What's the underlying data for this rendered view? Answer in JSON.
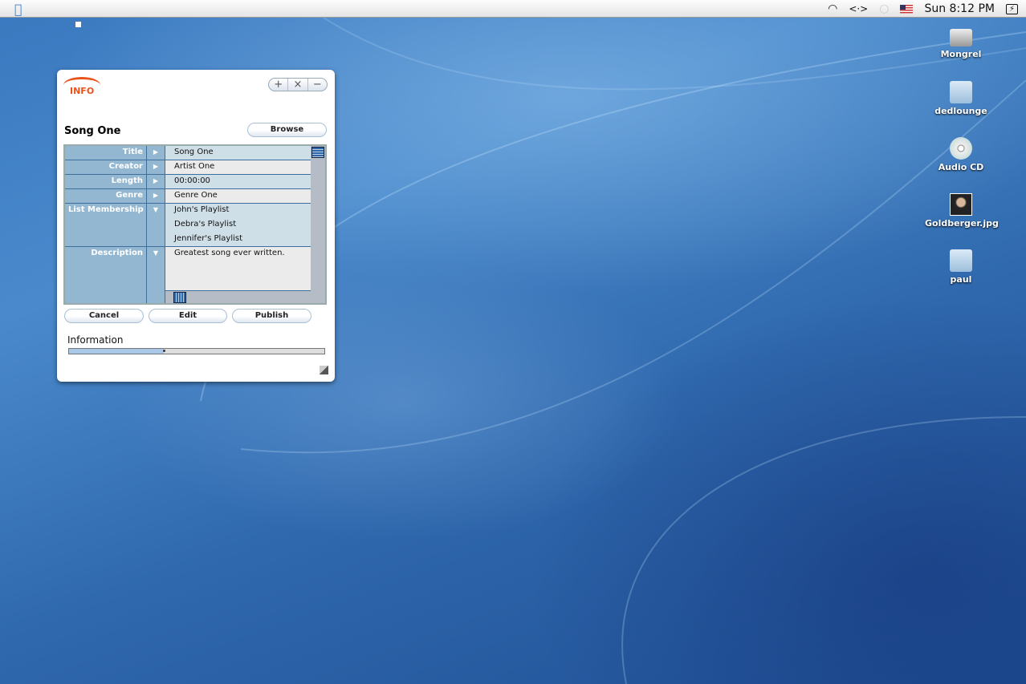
{
  "menubar": {
    "clock": "Sun 8:12 PM",
    "icons": [
      "apple-icon",
      "wifi-icon",
      "network-icon",
      "chat-icon",
      "flag-icon",
      "battery-icon"
    ]
  },
  "window": {
    "logo": "INFO",
    "controls": [
      "+",
      "×",
      "−"
    ],
    "song_title": "Song One",
    "browse_label": "Browse",
    "fields": [
      {
        "label": "Title",
        "values": [
          "Song One"
        ],
        "expanded": false
      },
      {
        "label": "Creator",
        "values": [
          "Artist One"
        ],
        "expanded": false
      },
      {
        "label": "Length",
        "values": [
          "00:00:00"
        ],
        "expanded": false
      },
      {
        "label": "Genre",
        "values": [
          "Genre One"
        ],
        "expanded": false
      },
      {
        "label": "List Membership",
        "values": [
          "John's Playlist",
          "Debra's Playlist",
          "Jennifer's Playlist"
        ],
        "expanded": true
      },
      {
        "label": "Description",
        "values": [
          "Greatest song ever written."
        ],
        "expanded": true
      }
    ],
    "buttons": {
      "cancel": "Cancel",
      "edit": "Edit",
      "publish": "Publish"
    },
    "info_label": "Information",
    "progress_percent": 37
  },
  "desktop_icons": [
    {
      "label": "Mongrel",
      "icon": "hard-drive-icon"
    },
    {
      "label": "dedlounge",
      "icon": "folder-icon"
    },
    {
      "label": "Audio CD",
      "icon": "cd-icon"
    },
    {
      "label": "Goldberger.jpg",
      "icon": "image-file-icon"
    },
    {
      "label": "paul",
      "icon": "folder-icon"
    }
  ]
}
